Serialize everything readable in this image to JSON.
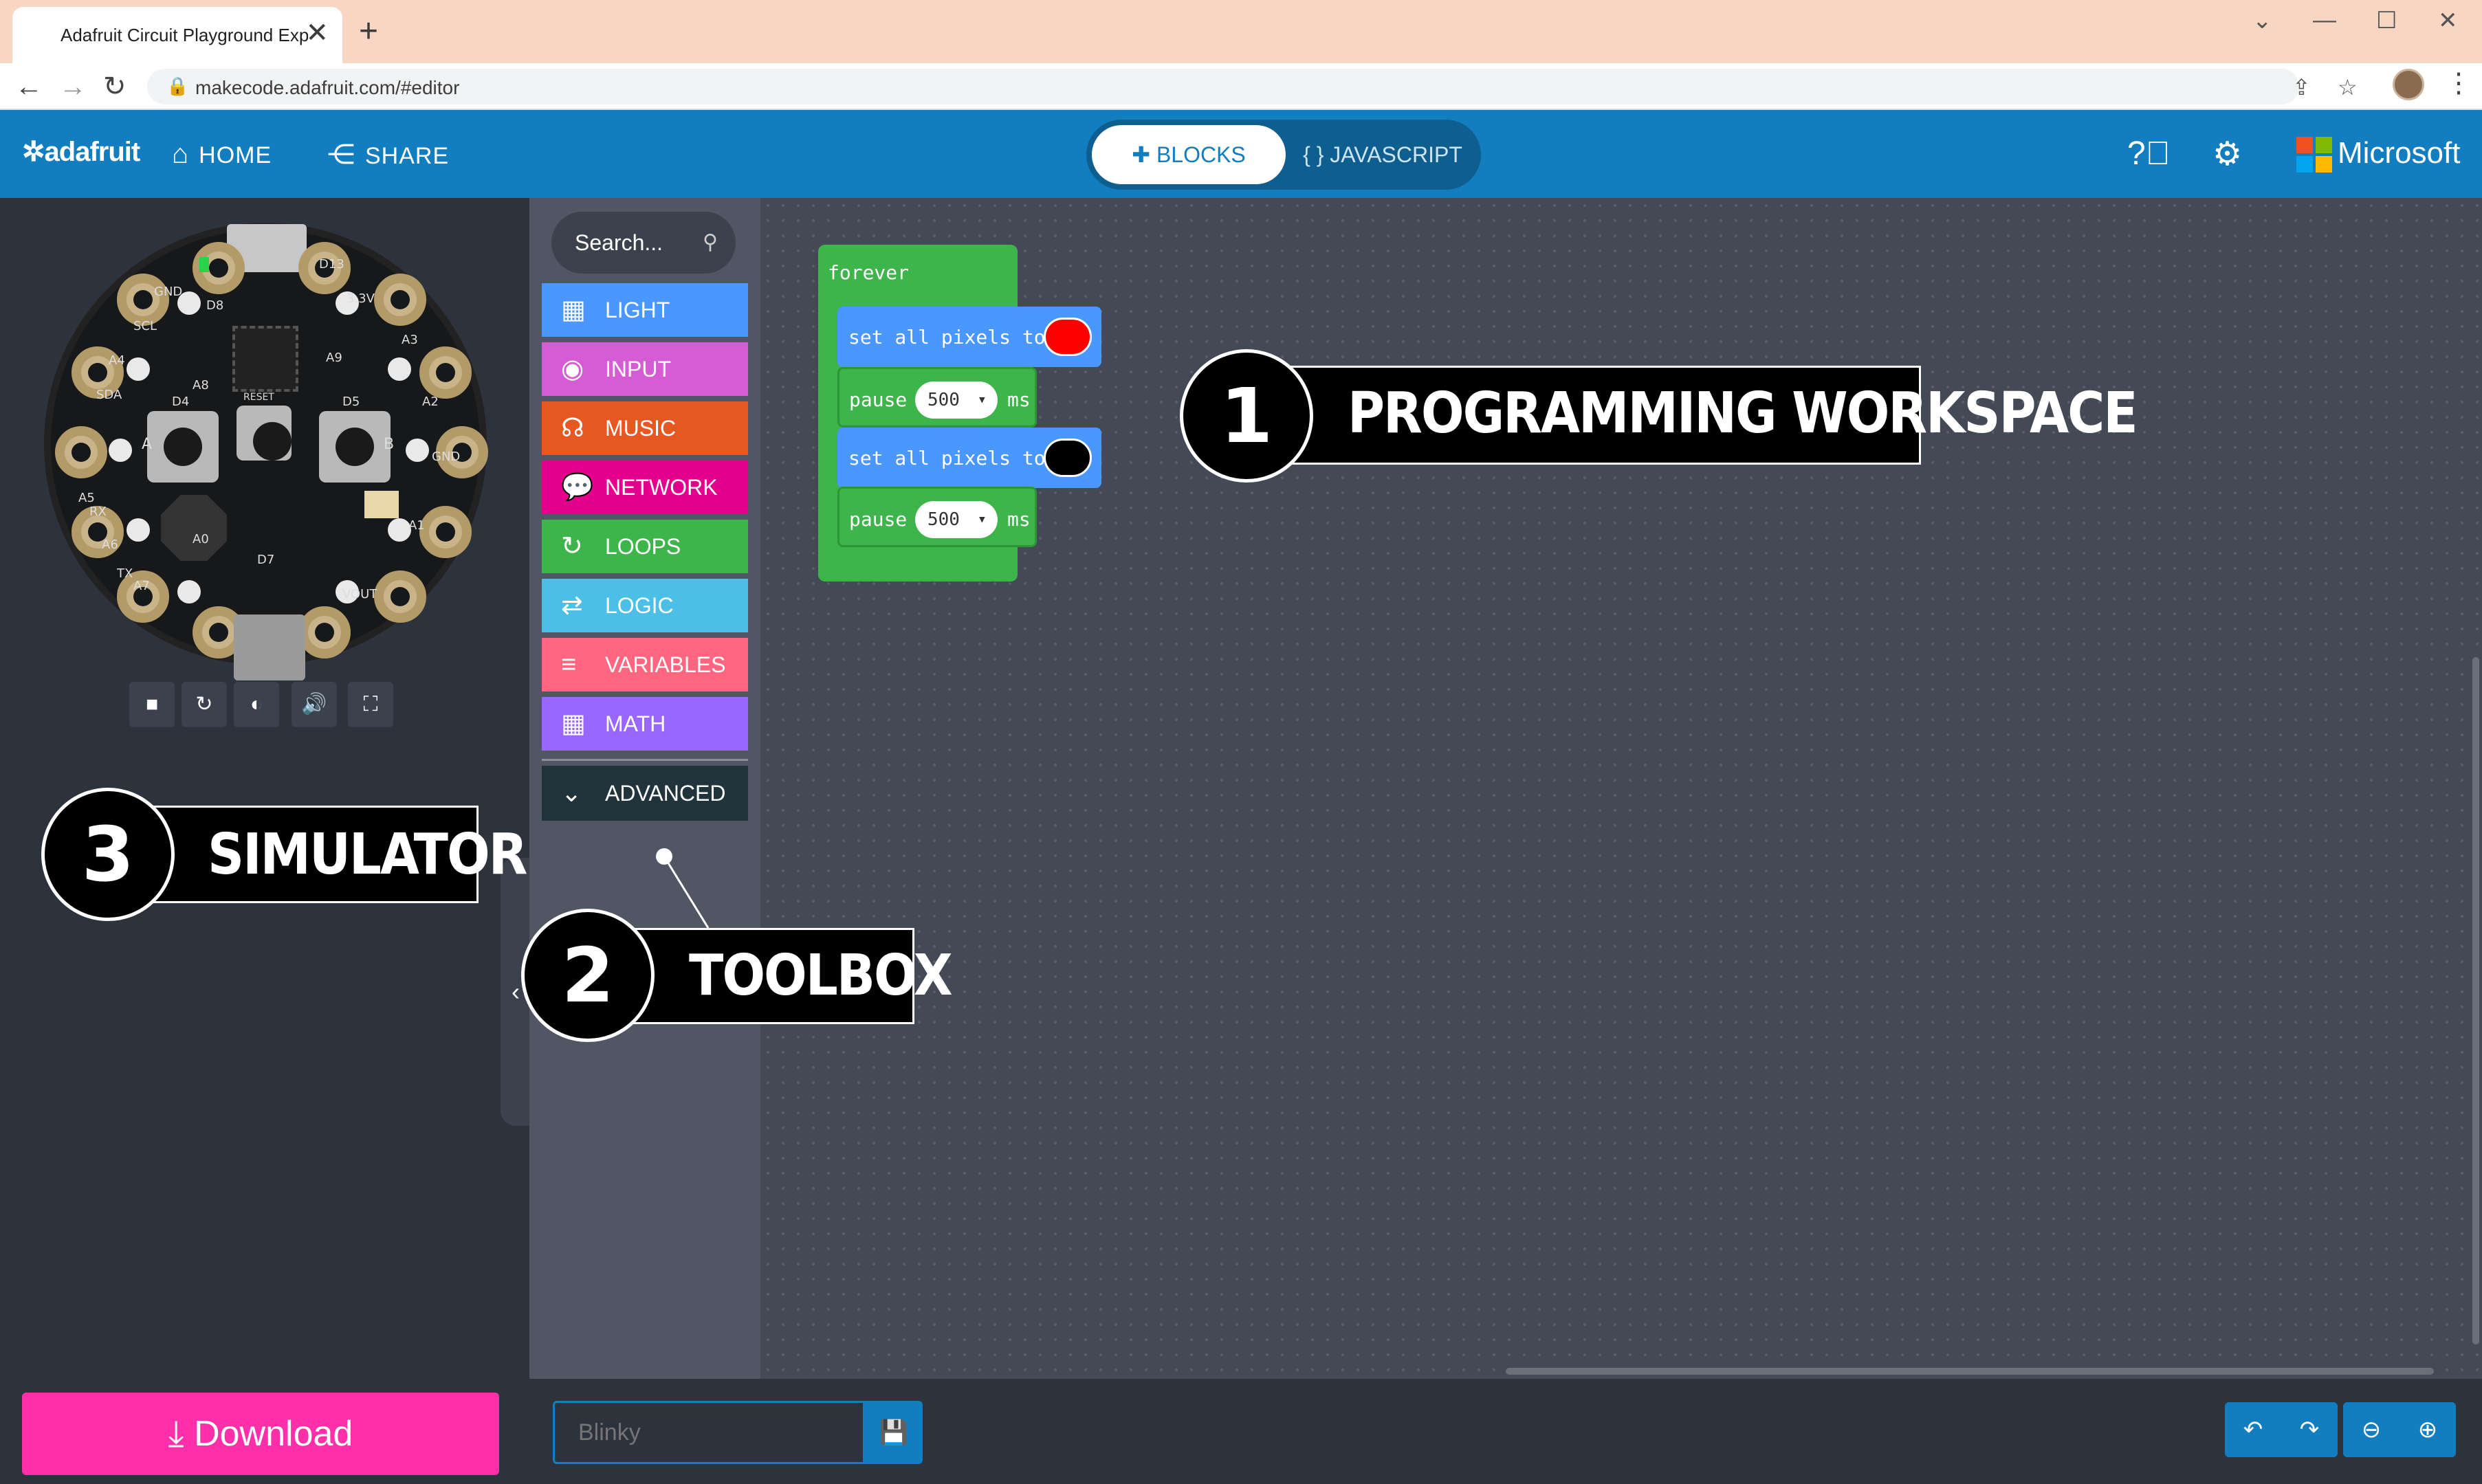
{
  "browser": {
    "tab_title": "Adafruit Circuit Playground Expre",
    "tab_close": "✕",
    "new_tab": "+",
    "url": "makecode.adafruit.com/#editor",
    "window_controls": [
      "⌄",
      "—",
      "☐",
      "✕"
    ]
  },
  "header": {
    "logo": "✲adafruit",
    "home_label": "HOME",
    "share_label": "SHARE",
    "blocks_label": "BLOCKS",
    "javascript_label": "JAVASCRIPT",
    "microsoft_label": "Microsoft"
  },
  "simulator": {
    "board_labels": [
      "D13",
      "GND",
      "3.3V",
      "A1",
      "A2",
      "A3",
      "GND",
      "A4",
      "A5",
      "A6",
      "A7",
      "VOUT",
      "SCL",
      "SDA",
      "RX",
      "TX",
      "RESET",
      "D4",
      "D5",
      "D7",
      "D8",
      "A8",
      "A9",
      "A0",
      "A",
      "B"
    ],
    "controls": [
      "■",
      "↻",
      "◐",
      "🔊",
      "⛶"
    ]
  },
  "toolbox": {
    "search_placeholder": "Search...",
    "categories": [
      {
        "label": "LIGHT",
        "icon": "grid-icon",
        "color": "#4a97ff"
      },
      {
        "label": "INPUT",
        "icon": "target-icon",
        "color": "#d65cd6"
      },
      {
        "label": "MUSIC",
        "icon": "headphones-icon",
        "color": "#e65722"
      },
      {
        "label": "NETWORK",
        "icon": "chat-icon",
        "color": "#e3008c"
      },
      {
        "label": "LOOPS",
        "icon": "refresh-icon",
        "color": "#3db54a"
      },
      {
        "label": "LOGIC",
        "icon": "shuffle-icon",
        "color": "#4cbfe6"
      },
      {
        "label": "VARIABLES",
        "icon": "list-icon",
        "color": "#ff6680"
      },
      {
        "label": "MATH",
        "icon": "calculator-icon",
        "color": "#9966ff"
      }
    ],
    "advanced_label": "ADVANCED"
  },
  "workspace": {
    "forever_label": "forever",
    "blocks": [
      {
        "type": "set",
        "text": "set all pixels to",
        "color": "#ff0000"
      },
      {
        "type": "pause",
        "text": "pause",
        "value": "500",
        "unit": "ms"
      },
      {
        "type": "set",
        "text": "set all pixels to",
        "color": "#000000"
      },
      {
        "type": "pause",
        "text": "pause",
        "value": "500",
        "unit": "ms"
      }
    ]
  },
  "callouts": [
    {
      "number": "1",
      "label": "PROGRAMMING WORKSPACE"
    },
    {
      "number": "2",
      "label": "TOOLBOX"
    },
    {
      "number": "3",
      "label": "SIMULATOR"
    }
  ],
  "footer": {
    "download_label": "Download",
    "project_name_placeholder": "Blinky"
  }
}
